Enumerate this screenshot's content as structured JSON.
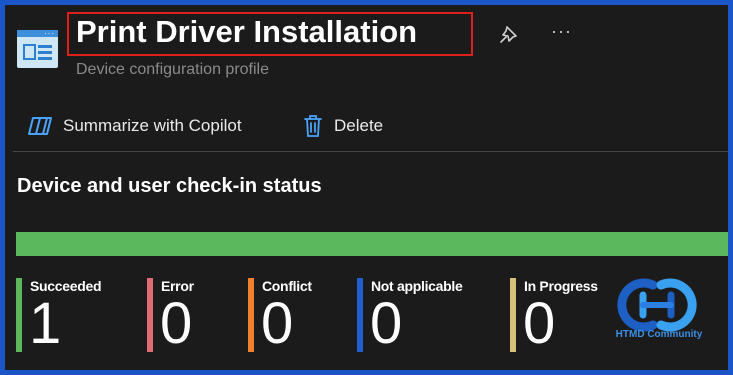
{
  "header": {
    "title": "Print Driver Installation",
    "subtitle": "Device configuration profile",
    "more_label": "···"
  },
  "toolbar": {
    "summarize_label": "Summarize with Copilot",
    "delete_label": "Delete"
  },
  "status": {
    "section_title": "Device and user check-in status",
    "progress_fraction": 1.0,
    "items": [
      {
        "label": "Succeeded",
        "value": "1",
        "color": "#5cb85c"
      },
      {
        "label": "Error",
        "value": "0",
        "color": "#e06c75"
      },
      {
        "label": "Conflict",
        "value": "0",
        "color": "#f07f2e"
      },
      {
        "label": "Not applicable",
        "value": "0",
        "color": "#1f5fcf"
      },
      {
        "label": "In Progress",
        "value": "0",
        "color": "#d9c07a"
      }
    ]
  },
  "watermark": {
    "text": "HTMD Community"
  },
  "colors": {
    "title_highlight": "#e0201d",
    "progress": "#5cb85c",
    "background": "#1b1b1b",
    "outer_border": "#1a56c8"
  },
  "icons": [
    "blade-profile-icon",
    "pin-icon",
    "more-icon",
    "copilot-icon",
    "trash-icon",
    "htmd-logo"
  ]
}
